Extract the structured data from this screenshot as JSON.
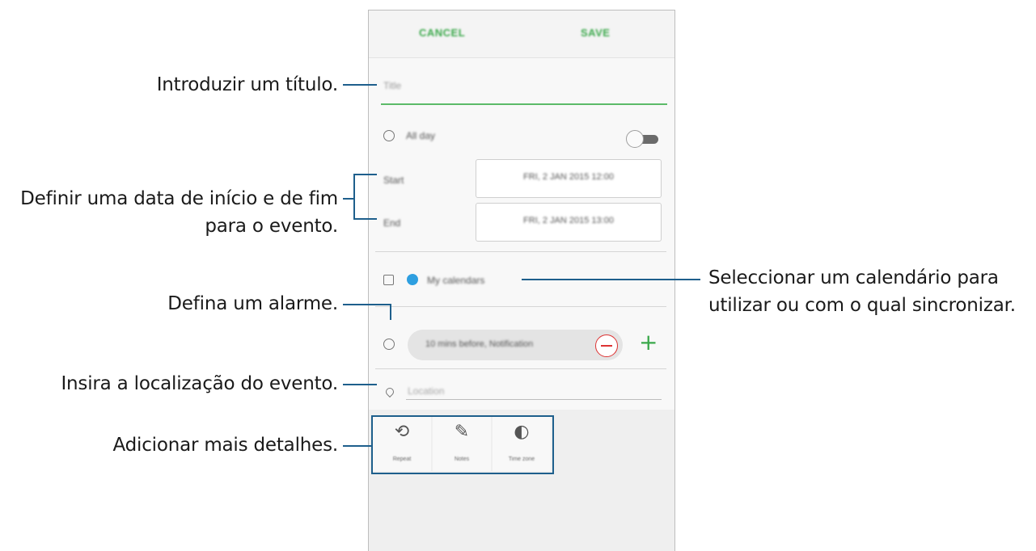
{
  "phone": {
    "cancel_label": "CANCEL",
    "save_label": "SAVE",
    "title_placeholder": "Title",
    "all_day_label": "All day",
    "start_label": "Start",
    "end_label": "End",
    "start_value": "FRI, 2 JAN 2015   12:00",
    "end_value": "FRI, 2 JAN 2015   13:00",
    "calendar_label": "My calendars",
    "alarm_value": "10 mins before, Notification",
    "location_placeholder": "Location",
    "detail_buttons": [
      {
        "label": "Repeat",
        "icon": "repeat-icon"
      },
      {
        "label": "Notes",
        "icon": "notes-icon"
      },
      {
        "label": "Time zone",
        "icon": "time-zone-icon"
      }
    ],
    "colors": {
      "accent_green": "#3aa84a",
      "calendar_dot": "#2e9fe0",
      "remove_red": "#dd3333"
    }
  },
  "callouts": {
    "title": "Introduzir um título.",
    "dates_line1": "Definir uma data de início e de fim",
    "dates_line2": "para o evento.",
    "calendar_line1": "Seleccionar um calendário para",
    "calendar_line2": "utilizar ou com o qual sincronizar.",
    "alarm": "Defina um alarme.",
    "location": "Insira a localização do evento.",
    "details": "Adicionar mais detalhes."
  },
  "callout_line_color": "#1e5f8c"
}
